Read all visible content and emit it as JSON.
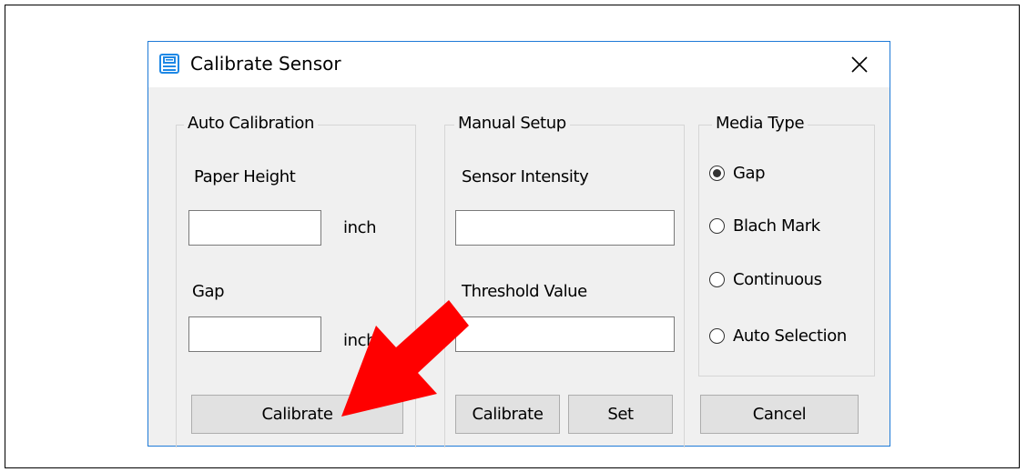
{
  "window": {
    "title": "Calibrate Sensor",
    "icon": "printer-app-icon",
    "close_icon": "close-icon"
  },
  "auto_calibration": {
    "legend": "Auto Calibration",
    "paper_height_label": "Paper Height",
    "paper_height_value": "",
    "paper_height_unit": "inch",
    "gap_label": "Gap",
    "gap_value": "",
    "gap_unit": "inch",
    "calibrate_label": "Calibrate"
  },
  "manual_setup": {
    "legend": "Manual Setup",
    "sensor_intensity_label": "Sensor Intensity",
    "sensor_intensity_value": "",
    "threshold_label": "Threshold Value",
    "threshold_value": "",
    "calibrate_label": "Calibrate",
    "set_label": "Set"
  },
  "media_type": {
    "legend": "Media Type",
    "options": [
      {
        "label": "Gap",
        "checked": true
      },
      {
        "label": "Blach Mark",
        "checked": false
      },
      {
        "label": "Continuous",
        "checked": false
      },
      {
        "label": "Auto Selection",
        "checked": false
      }
    ],
    "selected": "Gap"
  },
  "cancel_label": "Cancel",
  "annotation": {
    "arrow_color": "#ff0000",
    "arrow_icon": "red-arrow-pointer"
  },
  "colors": {
    "dialog_border": "#1e7ad7",
    "dialog_bg": "#f0f0f0",
    "button_bg": "#e1e1e1"
  }
}
